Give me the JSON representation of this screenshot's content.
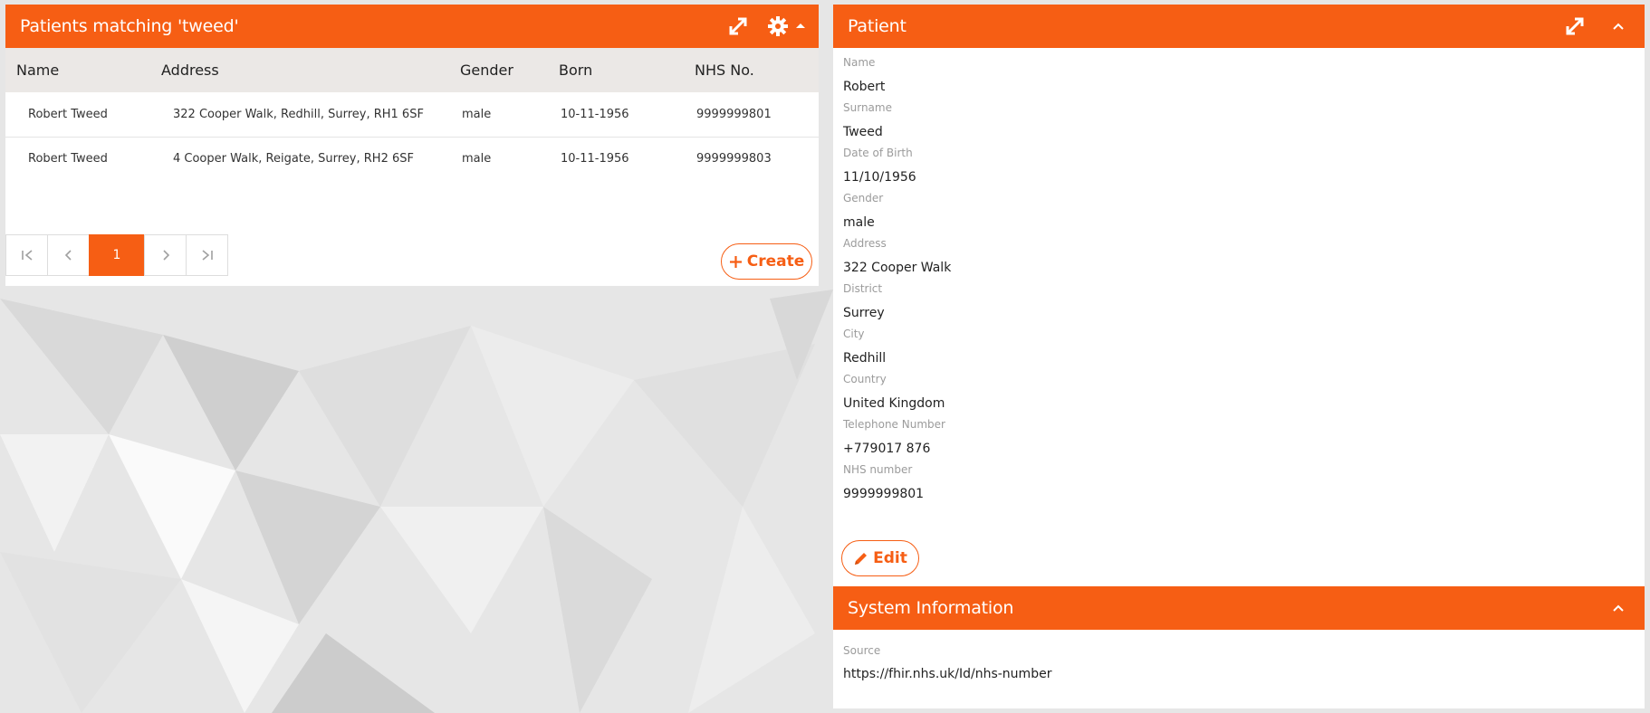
{
  "left": {
    "title": "Patients matching 'tweed'",
    "columns": [
      "Name",
      "Address",
      "Gender",
      "Born",
      "NHS No."
    ],
    "rows": [
      [
        "Robert Tweed",
        "322 Cooper Walk, Redhill, Surrey, RH1 6SF",
        "male",
        "10-11-1956",
        "9999999801"
      ],
      [
        "Robert Tweed",
        "4 Cooper Walk, Reigate, Surrey, RH2 6SF",
        "male",
        "10-11-1956",
        "9999999803"
      ]
    ],
    "pager": {
      "current_page": "1"
    },
    "create_label": "Create"
  },
  "patient": {
    "title": "Patient",
    "fields": [
      {
        "label": "Name",
        "value": "Robert"
      },
      {
        "label": "Surname",
        "value": "Tweed"
      },
      {
        "label": "Date of Birth",
        "value": "11/10/1956"
      },
      {
        "label": "Gender",
        "value": "male"
      },
      {
        "label": "Address",
        "value": "322 Cooper Walk"
      },
      {
        "label": "District",
        "value": "Surrey"
      },
      {
        "label": "City",
        "value": "Redhill"
      },
      {
        "label": "Country",
        "value": "United Kingdom"
      },
      {
        "label": "Telephone Number",
        "value": "+779017 876"
      },
      {
        "label": "NHS number",
        "value": "9999999801"
      }
    ],
    "edit_label": "Edit"
  },
  "system": {
    "title": "System Information",
    "source_label": "Source",
    "source_value": "https://fhir.nhs.uk/Id/nhs-number"
  },
  "colors": {
    "accent": "#f65e14",
    "header_bg": "#ebe8e6"
  }
}
